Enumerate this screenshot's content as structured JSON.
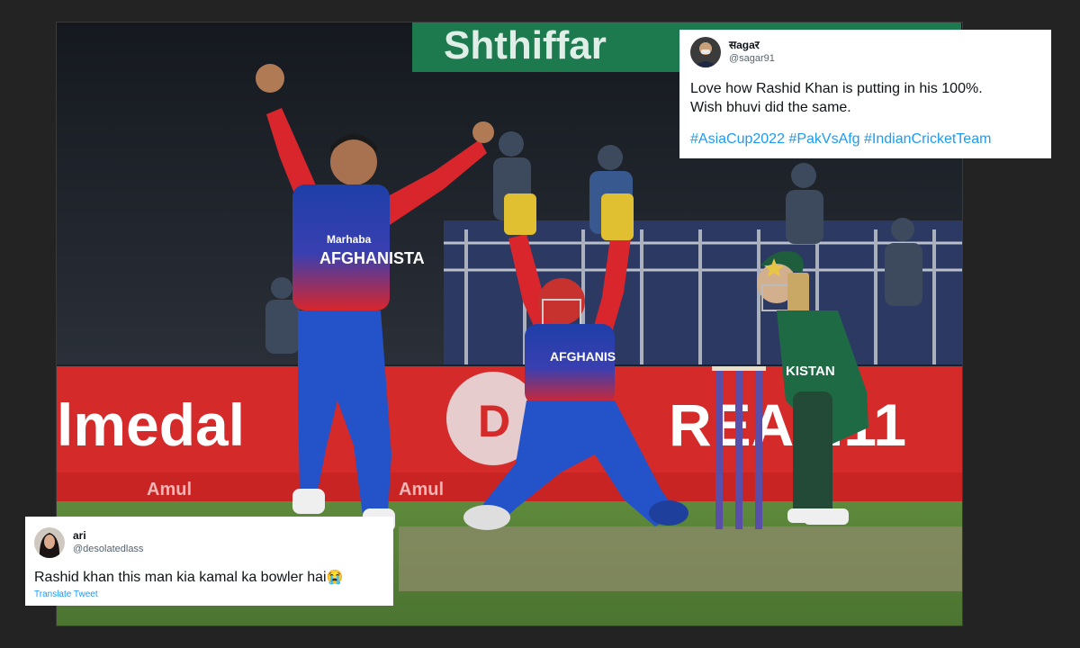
{
  "photo": {
    "sponsor_banner": "Shthiffar",
    "board_left": "lmedal",
    "board_right": "REAM11",
    "board_small": "Amul",
    "jersey_afg_1": "AFGHANISTA",
    "jersey_afg_2": "AFGHANIS",
    "jersey_pak": "KISTAN",
    "sponsor_patch": "Marhaba"
  },
  "tweets": [
    {
      "display_name": "सagaर",
      "handle": "@sagar91",
      "text_line1": "Love how Rashid Khan is putting in his 100%.",
      "text_line2": "Wish bhuvi did the same.",
      "hashtags": [
        "#AsiaCup2022",
        "#PakVsAfg",
        "#IndianCricketTeam"
      ]
    },
    {
      "display_name": "ari",
      "handle": "@desolatedlass",
      "text": "Rashid khan this man kia kamal ka bowler hai",
      "emoji": "😭",
      "translate_label": "Translate Tweet"
    }
  ],
  "colors": {
    "page_background": "#232323",
    "link_blue": "#1d9bf0",
    "afghanistan_red": "#d8262c",
    "afghanistan_blue": "#1e3fa8",
    "pakistan_green": "#1e6a45"
  }
}
